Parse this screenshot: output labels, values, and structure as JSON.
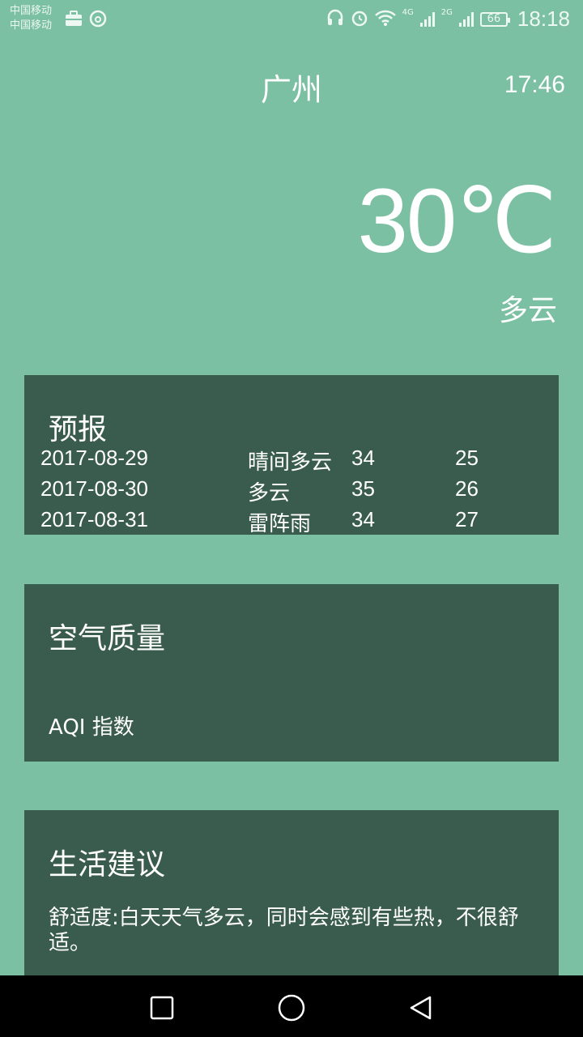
{
  "status_bar": {
    "carrier_1": "中国移动",
    "carrier_2": "中国移动",
    "network_1": "4G",
    "network_2": "2G",
    "battery": "66",
    "time": "18:18"
  },
  "header": {
    "city": "广州",
    "update_time": "17:46",
    "temperature": "30℃",
    "condition": "多云"
  },
  "forecast": {
    "title": "预报",
    "items": [
      {
        "date": "2017-08-29",
        "condition": "晴间多云",
        "max": "34",
        "min": "25"
      },
      {
        "date": "2017-08-30",
        "condition": "多云",
        "max": "35",
        "min": "26"
      },
      {
        "date": "2017-08-31",
        "condition": "雷阵雨",
        "max": "34",
        "min": "27"
      }
    ]
  },
  "aqi": {
    "title": "空气质量",
    "label": "AQI 指数"
  },
  "suggestion": {
    "title": "生活建议",
    "comfort": "舒适度:白天天气多云，同时会感到有些热，不很舒适。"
  },
  "colors": {
    "background": "#7cc0a3",
    "card": "#3a5c4f",
    "text": "#ffffff"
  }
}
